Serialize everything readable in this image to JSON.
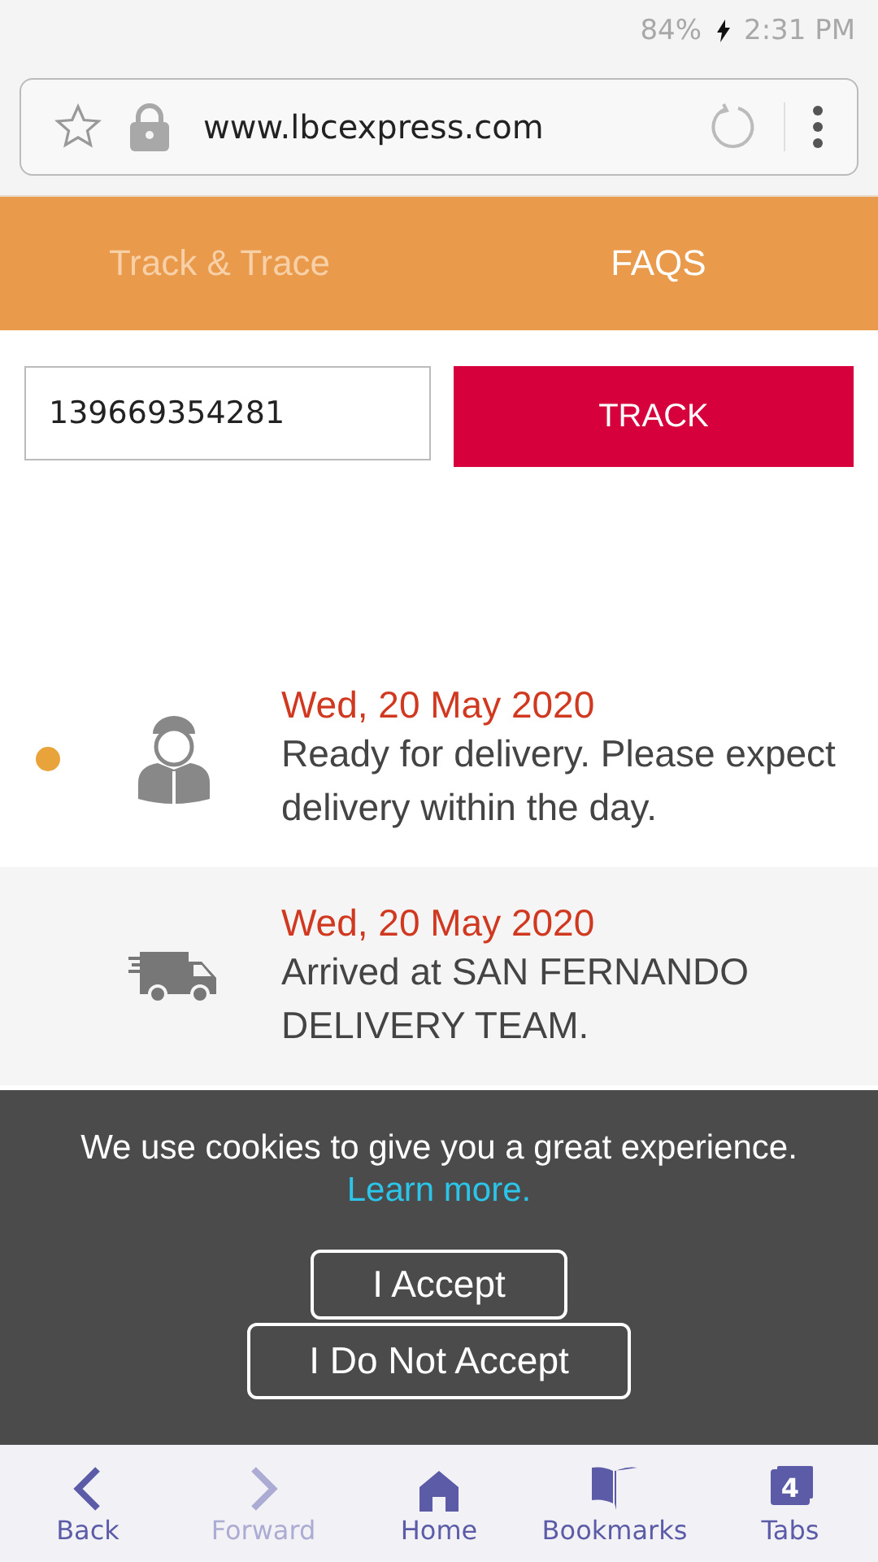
{
  "status_bar": {
    "battery": "84%",
    "time": "2:31 PM"
  },
  "address_bar": {
    "url": "www.lbcexpress.com"
  },
  "tabs": [
    {
      "label": "Track & Trace",
      "selected": false
    },
    {
      "label": "FAQS",
      "selected": true
    }
  ],
  "tracking": {
    "value": "139669354281",
    "button": "TRACK"
  },
  "events": [
    {
      "kind": "courier",
      "current": true,
      "date": "Wed, 20 May 2020",
      "text": "Ready for delivery. Please expect delivery within the day."
    },
    {
      "kind": "truck",
      "current": false,
      "date": "Wed, 20 May 2020",
      "text": "Arrived at SAN FERNANDO DELIVERY TEAM."
    }
  ],
  "cookie_banner": {
    "message": "We use cookies to give you a great experience.",
    "link": "Learn more.",
    "buttons": [
      "I Accept",
      "I Do Not Accept"
    ]
  },
  "nav": [
    {
      "kind": "back",
      "label": "Back",
      "disabled": false
    },
    {
      "kind": "forward",
      "label": "Forward",
      "disabled": true
    },
    {
      "kind": "home",
      "label": "Home",
      "disabled": false
    },
    {
      "kind": "bookmarks",
      "label": "Bookmarks",
      "disabled": false
    },
    {
      "kind": "tabs",
      "label": "Tabs",
      "disabled": false,
      "count": "4"
    }
  ]
}
